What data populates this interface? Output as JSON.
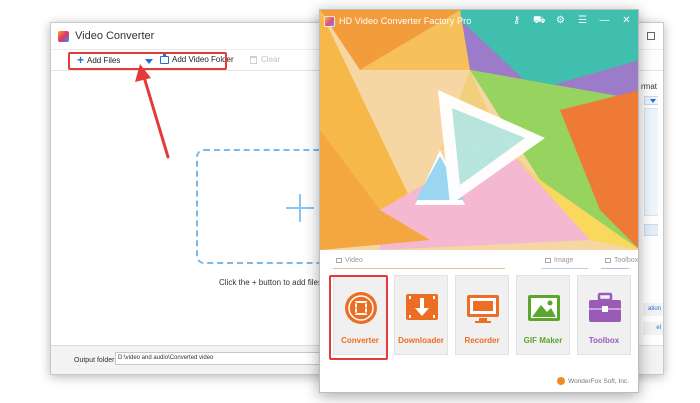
{
  "background_window": {
    "title": "Video Converter",
    "toolbar": {
      "add_files": "Add Files",
      "add_video_folder": "Add Video Folder",
      "clear": "Clear"
    },
    "right_panel_fragment": "rmat",
    "drop_hint": "Click the + button to add files/folders",
    "output_label": "Output folder:",
    "output_path": "D:\\video and audio\\Converted video",
    "side_tags": [
      "ation",
      "el"
    ]
  },
  "main_window": {
    "title": "HD Video Converter Factory Pro",
    "controls": [
      "key-icon",
      "cart-icon",
      "gear-icon",
      "menu-icon",
      "minimize-icon",
      "close-icon"
    ],
    "categories": {
      "video": "Video",
      "image": "Image",
      "toolbox": "Toolbox"
    },
    "tiles": [
      {
        "label": "Converter",
        "color": "#ec6e24",
        "icon": "film-reel-icon"
      },
      {
        "label": "Downloader",
        "color": "#ec6e24",
        "icon": "download-icon"
      },
      {
        "label": "Recorder",
        "color": "#ec6e24",
        "icon": "screen-record-icon"
      },
      {
        "label": "GIF Maker",
        "color": "#5aa72c",
        "icon": "image-icon"
      },
      {
        "label": "Toolbox",
        "color": "#9a5bb7",
        "icon": "toolbox-icon"
      }
    ],
    "footer": "WonderFox Soft, Inc."
  },
  "annotations": {
    "highlight_color": "#e43a3a"
  }
}
